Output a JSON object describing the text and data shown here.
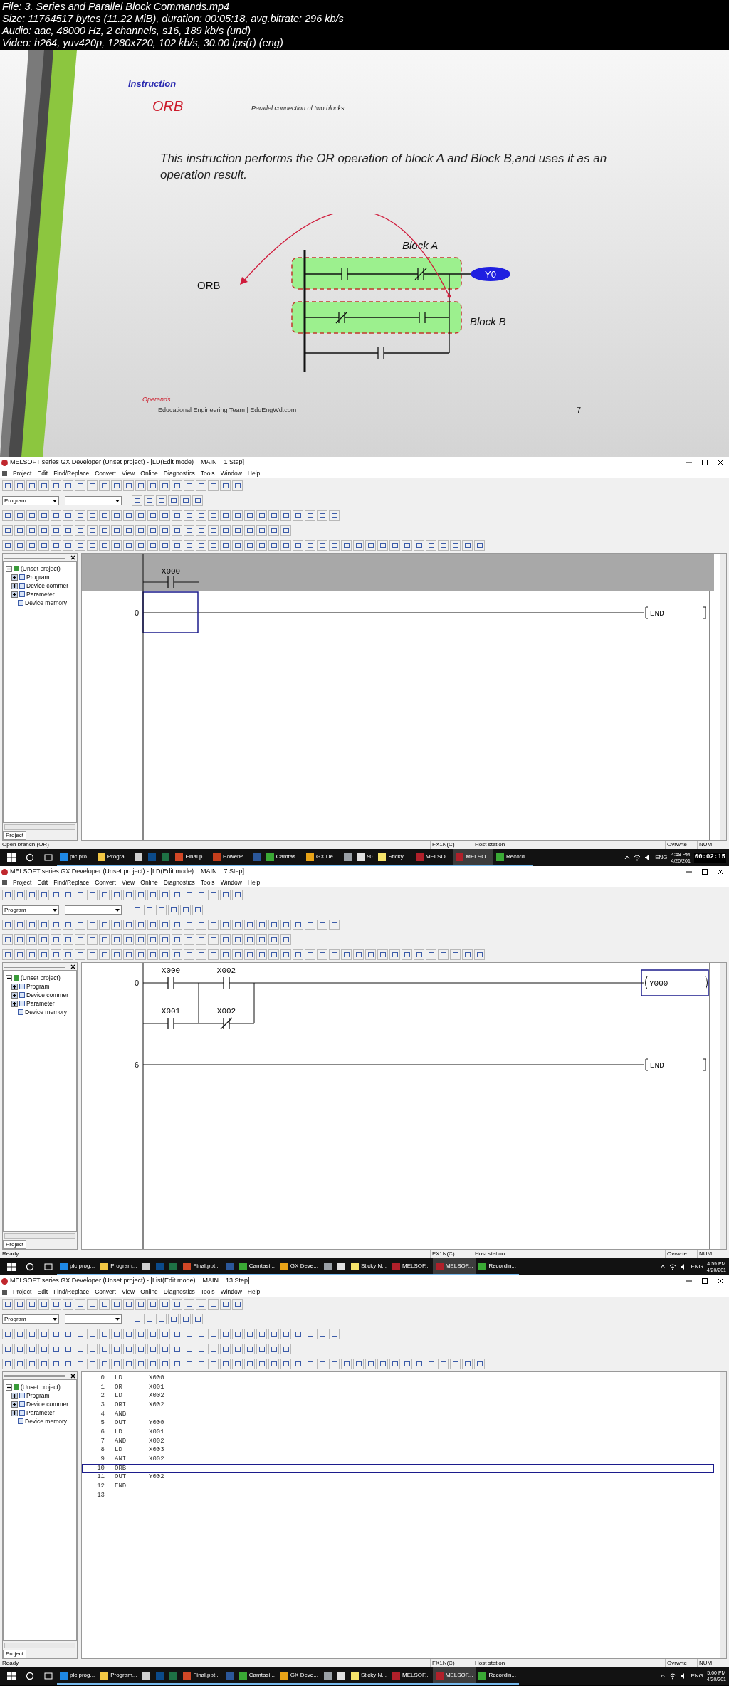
{
  "file_info": [
    "File: 3. Series and Parallel Block Commands.mp4",
    "Size: 11764517 bytes (11.22 MiB), duration: 00:05:18, avg.bitrate: 296 kb/s",
    "Audio: aac, 48000 Hz, 2 channels, s16, 189 kb/s (und)",
    "Video: h264, yuv420p, 1280x720, 102 kb/s, 30.00 fps(r) (eng)"
  ],
  "slide": {
    "heading": "Instruction",
    "title": "ORB",
    "subtitle": "Parallel connection of two blocks",
    "body": "This instruction performs the OR operation of block A and Block B,and uses it as an operation result.",
    "diagram": {
      "block_a": "Block A",
      "block_b": "Block B",
      "pointer": "ORB",
      "coil": "Y0"
    },
    "operands": "Operands",
    "footer": "Educational Engineering Team | EduEngWd.com",
    "page": "7"
  },
  "frames": [
    {
      "title": "MELSOFT series GX Developer (Unset project) - [LD(Edit mode)    MAIN    1 Step]",
      "menu": [
        "Project",
        "Edit",
        "Find/Replace",
        "Convert",
        "View",
        "Online",
        "Diagnostics",
        "Tools",
        "Window",
        "Help"
      ],
      "mode_dropdown": "Program",
      "tree": {
        "label": "(Unset project)",
        "expanded": true,
        "children": [
          {
            "label": "Program",
            "expanded": false
          },
          {
            "label": "Device commer",
            "expanded": false
          },
          {
            "label": "Parameter",
            "expanded": false
          },
          {
            "label": "Device memory"
          }
        ]
      },
      "tree_tab": "Project",
      "view": {
        "kind": "ladder",
        "preview": [
          {
            "label": "X000",
            "kind": "no"
          }
        ],
        "rungs": [
          {
            "step": "0",
            "cursor": true,
            "end": "END"
          }
        ]
      },
      "status": {
        "message": "Open branch (OR)",
        "plc": "FX1N(C)",
        "station": "Host station",
        "mode": "Ovrwrte",
        "num": "NUM"
      },
      "taskbar": {
        "items": [
          {
            "label": "plc pro...",
            "color": "#1e88e5",
            "selected": false
          },
          {
            "label": "Progra...",
            "color": "#f2c744",
            "selected": false
          },
          {
            "color": "#d0d0d0",
            "selected": false
          },
          {
            "color": "#0b4a8a",
            "selected": false
          },
          {
            "color": "#1e7145",
            "selected": false
          },
          {
            "label": "Final.p...",
            "color": "#d24726",
            "selected": false
          },
          {
            "label": "PowerP...",
            "color": "#c43e1c",
            "selected": false
          },
          {
            "color": "#2b579a",
            "selected": false
          },
          {
            "label": "Camtas...",
            "color": "#3aa935",
            "selected": false
          },
          {
            "label": "GX De...",
            "color": "#e8a317",
            "selected": false
          },
          {
            "color": "#9aa0a6",
            "selected": false
          },
          {
            "color": "#e0e0e0",
            "badge": "90",
            "selected": false
          },
          {
            "label": "Sticky ...",
            "color": "#f6e36b",
            "selected": false
          },
          {
            "label": "MELSO...",
            "color": "#b0202a",
            "selected": false
          },
          {
            "label": "MELSO...",
            "color": "#b0202a",
            "selected": true
          },
          {
            "label": "Record...",
            "color": "#3aa935",
            "selected": false
          }
        ],
        "lang": "ENG",
        "time": "4:58 PM",
        "date": "4/20/201"
      },
      "timestamp": "00:02:15"
    },
    {
      "title": "MELSOFT series GX Developer (Unset project) - [LD(Edit mode)    MAIN    7 Step]",
      "menu": [
        "Project",
        "Edit",
        "Find/Replace",
        "Convert",
        "View",
        "Online",
        "Diagnostics",
        "Tools",
        "Window",
        "Help"
      ],
      "mode_dropdown": "Program",
      "tree": {
        "label": "(Unset project)",
        "expanded": true,
        "children": [
          {
            "label": "Program",
            "expanded": false
          },
          {
            "label": "Device commer",
            "expanded": false
          },
          {
            "label": "Parameter",
            "expanded": false
          },
          {
            "label": "Device memory"
          }
        ]
      },
      "tree_tab": "Project",
      "view": {
        "kind": "ladder",
        "rungs": [
          {
            "step": "0",
            "blocks": [
              {
                "branches": [
                  [
                    {
                      "label": "X000",
                      "kind": "no"
                    }
                  ],
                  [
                    {
                      "label": "X001",
                      "kind": "no"
                    }
                  ]
                ]
              },
              {
                "branches": [
                  [
                    {
                      "label": "X002",
                      "kind": "no"
                    }
                  ],
                  [
                    {
                      "label": "X002",
                      "kind": "nc"
                    }
                  ]
                ]
              }
            ],
            "coil": {
              "label": "Y000",
              "selected": true
            }
          },
          {
            "step": "6",
            "end": "END"
          }
        ]
      },
      "status": {
        "message": "Ready",
        "plc": "FX1N(C)",
        "station": "Host station",
        "mode": "Ovrwrte",
        "num": "NUM"
      },
      "taskbar": {
        "items": [
          {
            "label": "plc prog...",
            "color": "#1e88e5",
            "selected": false
          },
          {
            "label": "Program...",
            "color": "#f2c744",
            "selected": false
          },
          {
            "color": "#d0d0d0",
            "selected": false
          },
          {
            "color": "#0b4a8a",
            "selected": false
          },
          {
            "color": "#1e7145",
            "selected": false
          },
          {
            "label": "Final.ppt...",
            "color": "#d24726",
            "selected": false
          },
          {
            "color": "#2b579a",
            "selected": false
          },
          {
            "label": "Camtasi...",
            "color": "#3aa935",
            "selected": false
          },
          {
            "label": "GX Deve...",
            "color": "#e8a317",
            "selected": false
          },
          {
            "color": "#9aa0a6",
            "selected": false
          },
          {
            "color": "#e0e0e0",
            "selected": false
          },
          {
            "label": "Sticky N...",
            "color": "#f6e36b",
            "selected": false
          },
          {
            "label": "MELSOF...",
            "color": "#b0202a",
            "selected": false
          },
          {
            "label": "MELSOF...",
            "color": "#b0202a",
            "selected": true
          },
          {
            "label": "Recordin...",
            "color": "#3aa935",
            "selected": false
          }
        ],
        "lang": "ENG",
        "time": "4:59 PM",
        "date": "4/20/201"
      }
    },
    {
      "title": "MELSOFT series GX Developer (Unset project) - [List(Edit mode)    MAIN    13 Step]",
      "menu": [
        "Project",
        "Edit",
        "Find/Replace",
        "Convert",
        "View",
        "Online",
        "Diagnostics",
        "Tools",
        "Window",
        "Help"
      ],
      "mode_dropdown": "Program",
      "tree": {
        "label": "(Unset project)",
        "expanded": true,
        "children": [
          {
            "label": "Program",
            "expanded": false
          },
          {
            "label": "Device commer",
            "expanded": false
          },
          {
            "label": "Parameter",
            "expanded": false
          },
          {
            "label": "Device memory"
          }
        ]
      },
      "tree_tab": "Project",
      "view": {
        "kind": "list",
        "rows": [
          {
            "step": "0",
            "instruction": "LD",
            "operand": "X000",
            "selected": false
          },
          {
            "step": "1",
            "instruction": "OR",
            "operand": "X001",
            "selected": false
          },
          {
            "step": "2",
            "instruction": "LD",
            "operand": "X002",
            "selected": false
          },
          {
            "step": "3",
            "instruction": "ORI",
            "operand": "X002",
            "selected": false
          },
          {
            "step": "4",
            "instruction": "ANB",
            "selected": false
          },
          {
            "step": "5",
            "instruction": "OUT",
            "operand": "Y000",
            "selected": false
          },
          {
            "step": "6",
            "instruction": "LD",
            "operand": "X001",
            "selected": false
          },
          {
            "step": "7",
            "instruction": "AND",
            "operand": "X002",
            "selected": false
          },
          {
            "step": "8",
            "instruction": "LD",
            "operand": "X003",
            "selected": false
          },
          {
            "step": "9",
            "instruction": "ANI",
            "operand": "X002",
            "selected": false
          },
          {
            "step": "10",
            "instruction": "ORB",
            "selected": true
          },
          {
            "step": "11",
            "instruction": "OUT",
            "operand": "Y002",
            "selected": false
          },
          {
            "step": "12",
            "instruction": "END",
            "selected": false
          },
          {
            "step": "13",
            "selected": false
          }
        ]
      },
      "status": {
        "message": "Ready",
        "plc": "FX1N(C)",
        "station": "Host station",
        "mode": "Ovrwrte",
        "num": "NUM"
      },
      "taskbar": {
        "items": [
          {
            "label": "plc prog...",
            "color": "#1e88e5",
            "selected": false
          },
          {
            "label": "Program...",
            "color": "#f2c744",
            "selected": false
          },
          {
            "color": "#d0d0d0",
            "selected": false
          },
          {
            "color": "#0b4a8a",
            "selected": false
          },
          {
            "color": "#1e7145",
            "selected": false
          },
          {
            "label": "Final.ppt...",
            "color": "#d24726",
            "selected": false
          },
          {
            "color": "#2b579a",
            "selected": false
          },
          {
            "label": "Camtasi...",
            "color": "#3aa935",
            "selected": false
          },
          {
            "label": "GX Deve...",
            "color": "#e8a317",
            "selected": false
          },
          {
            "color": "#9aa0a6",
            "selected": false
          },
          {
            "color": "#e0e0e0",
            "selected": false
          },
          {
            "label": "Sticky N...",
            "color": "#f6e36b",
            "selected": false
          },
          {
            "label": "MELSOF...",
            "color": "#b0202a",
            "selected": false
          },
          {
            "label": "MELSOF...",
            "color": "#b0202a",
            "selected": true
          },
          {
            "label": "Recordin...",
            "color": "#3aa935",
            "selected": false
          }
        ],
        "lang": "ENG",
        "time": "5:00 PM",
        "date": "4/20/201"
      }
    }
  ]
}
